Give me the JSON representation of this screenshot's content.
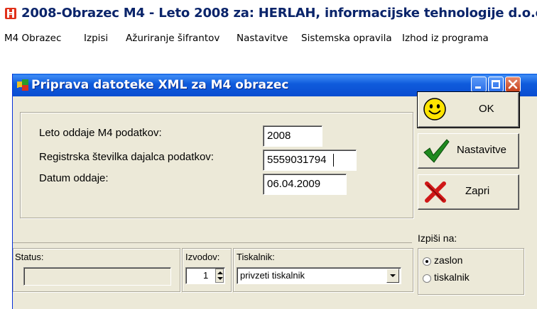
{
  "app": {
    "title": "2008-Obrazec M4 - Leto 2008 za: HERLAH, informacijske tehnologije d.o.o."
  },
  "menu": {
    "items": [
      "M4 Obrazec",
      "Izpisi",
      "Ažuriranje šifrantov",
      "Nastavitve",
      "Sistemska opravila",
      "Izhod iz programa"
    ]
  },
  "dialog": {
    "title": "Priprava datoteke XML za M4 obrazec",
    "fields": {
      "year_label": "Leto oddaje M4 podatkov:",
      "year_value": "2008",
      "reg_label": "Registrska številka dajalca podatkov:",
      "reg_value": "5559031794",
      "date_label": "Datum oddaje:",
      "date_value": "06.04.2009"
    },
    "buttons": {
      "ok": "OK",
      "settings": "Nastavitve",
      "close": "Zapri"
    },
    "status": {
      "label": "Status:",
      "value": ""
    },
    "copies": {
      "label": "Izvodov:",
      "value": "1"
    },
    "printer": {
      "label": "Tiskalnik:",
      "value": "privzeti tiskalnik"
    },
    "output": {
      "label": "Izpiši na:",
      "options": [
        "zaslon",
        "tiskalnik"
      ],
      "selected": "zaslon"
    }
  },
  "colors": {
    "titlebar": "#0a4dd0",
    "dialog_bg": "#ece9d8",
    "app_title_text": "#0a246a",
    "logo_red": "#e0311a"
  }
}
